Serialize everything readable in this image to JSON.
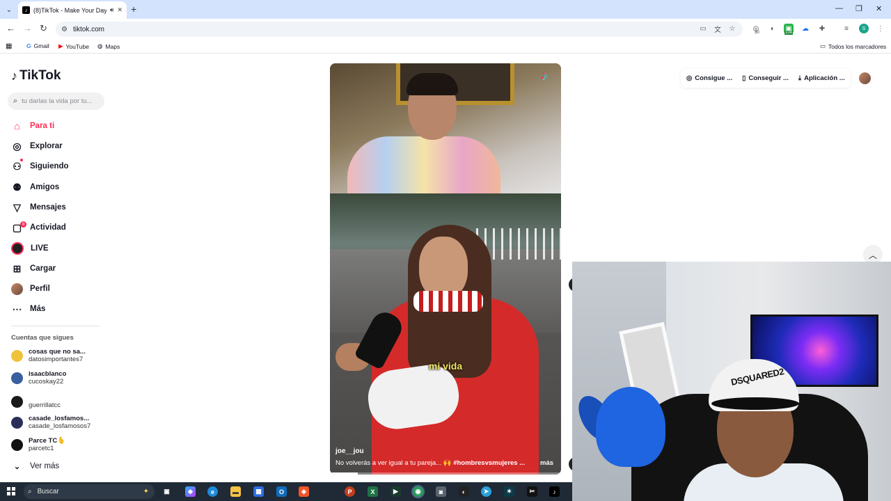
{
  "browser": {
    "tab_title": "(8)TikTok - Make Your Day",
    "url": "tiktok.com",
    "bookmarks": [
      "Gmail",
      "YouTube",
      "Maps"
    ],
    "all_bookmarks": "Todos los marcadores",
    "ext_badge_1": "30",
    "ext_badge_2": "104",
    "profile_letter": "S"
  },
  "tiktok": {
    "logo_text": "TikTok",
    "search_placeholder": "tu darlas la vida por tu...",
    "nav": [
      {
        "label": "Para ti",
        "icon": "home-icon"
      },
      {
        "label": "Explorar",
        "icon": "compass-icon"
      },
      {
        "label": "Siguiendo",
        "icon": "following-icon"
      },
      {
        "label": "Amigos",
        "icon": "friends-icon"
      },
      {
        "label": "Mensajes",
        "icon": "messages-icon"
      },
      {
        "label": "Actividad",
        "icon": "activity-icon"
      },
      {
        "label": "LIVE",
        "icon": "live-icon"
      },
      {
        "label": "Cargar",
        "icon": "upload-icon"
      },
      {
        "label": "Perfil",
        "icon": "profile-icon"
      },
      {
        "label": "Más",
        "icon": "more-icon"
      }
    ],
    "activity_badge": "8",
    "following_title": "Cuentas que sigues",
    "following": [
      {
        "name": "cosas que no sa...",
        "handle": "datosimportantes7",
        "color": "#f0c23a"
      },
      {
        "name": "isaacblanco",
        "handle": "cucoskay22",
        "color": "#3a5fa0"
      },
      {
        "name": "",
        "handle": "guerrillatcc",
        "color": "#1a1a1a"
      },
      {
        "name": "casade_losfamos...",
        "handle": "casade_losfamosos7",
        "color": "#2a2f5a"
      },
      {
        "name": "Parce TC🫰",
        "handle": "parcetc1",
        "color": "#111111"
      }
    ],
    "see_more": "Ver más",
    "video": {
      "username": "joe__jou",
      "description": "No volverás a ver igual a tu pareja... 🙌 ",
      "hashtag": "#hombresvsmujeres ...",
      "more": "más",
      "caption": "mi vida",
      "progress": 0.12
    },
    "top_actions": [
      "Consigue ...",
      "Conseguir ...",
      "Aplicación ..."
    ]
  },
  "webcam": {
    "cap_text": "DSQUARED2"
  },
  "taskbar": {
    "search_label": "Buscar"
  },
  "colors": {
    "accent": "#fe2c55",
    "tab_strip": "#d3e3fd",
    "taskbar": "#1f2a36"
  }
}
